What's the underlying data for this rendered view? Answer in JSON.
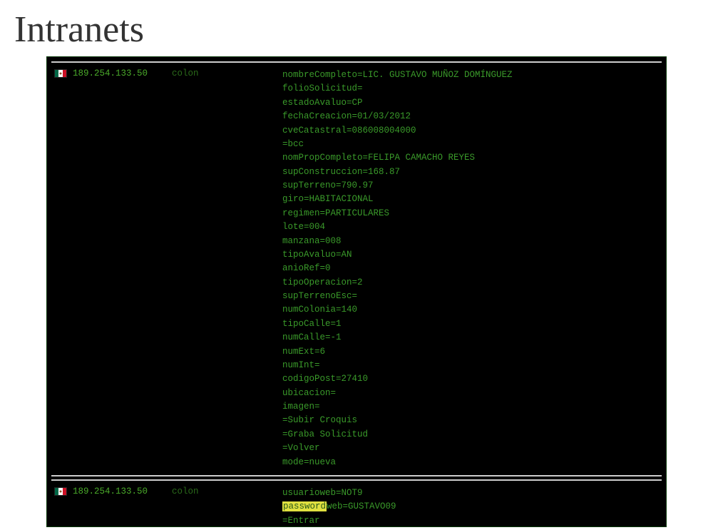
{
  "title": "Intranets",
  "records": [
    {
      "ip": "189.254.133.50",
      "host": "colon",
      "flag": "mx",
      "lines": [
        {
          "text": "nombreCompleto=LIC. GUSTAVO MUÑOZ DOMÍNGUEZ"
        },
        {
          "text": "folioSolicitud="
        },
        {
          "text": "estadoAvaluo=CP"
        },
        {
          "text": "fechaCreacion=01/03/2012"
        },
        {
          "text": "cveCatastral=086008004000"
        },
        {
          "text": "=bcc"
        },
        {
          "text": "nomPropCompleto=FELIPA CAMACHO REYES"
        },
        {
          "text": "supConstruccion=168.87"
        },
        {
          "text": "supTerreno=790.97"
        },
        {
          "text": "giro=HABITACIONAL"
        },
        {
          "text": "regimen=PARTICULARES"
        },
        {
          "text": "lote=004"
        },
        {
          "text": "manzana=008"
        },
        {
          "text": "tipoAvaluo=AN"
        },
        {
          "text": "anioRef=0"
        },
        {
          "text": "tipoOperacion=2"
        },
        {
          "text": "supTerrenoEsc="
        },
        {
          "text": "numColonia=140"
        },
        {
          "text": "tipoCalle=1"
        },
        {
          "text": "numCalle=-1"
        },
        {
          "text": "numExt=6"
        },
        {
          "text": "numInt="
        },
        {
          "text": "codigoPost=27410"
        },
        {
          "text": "ubicacion="
        },
        {
          "text": "imagen="
        },
        {
          "text": "=Subir Croquis"
        },
        {
          "text": "=Graba Solicitud"
        },
        {
          "text": "=Volver"
        },
        {
          "text": "mode=nueva"
        }
      ]
    },
    {
      "ip": "189.254.133.50",
      "host": "colon",
      "flag": "mx",
      "lines": [
        {
          "text": "usuarioweb=NOT9"
        },
        {
          "prefixHighlight": "password",
          "text": "web=GUSTAVO09"
        },
        {
          "text": "=Entrar"
        }
      ]
    }
  ]
}
